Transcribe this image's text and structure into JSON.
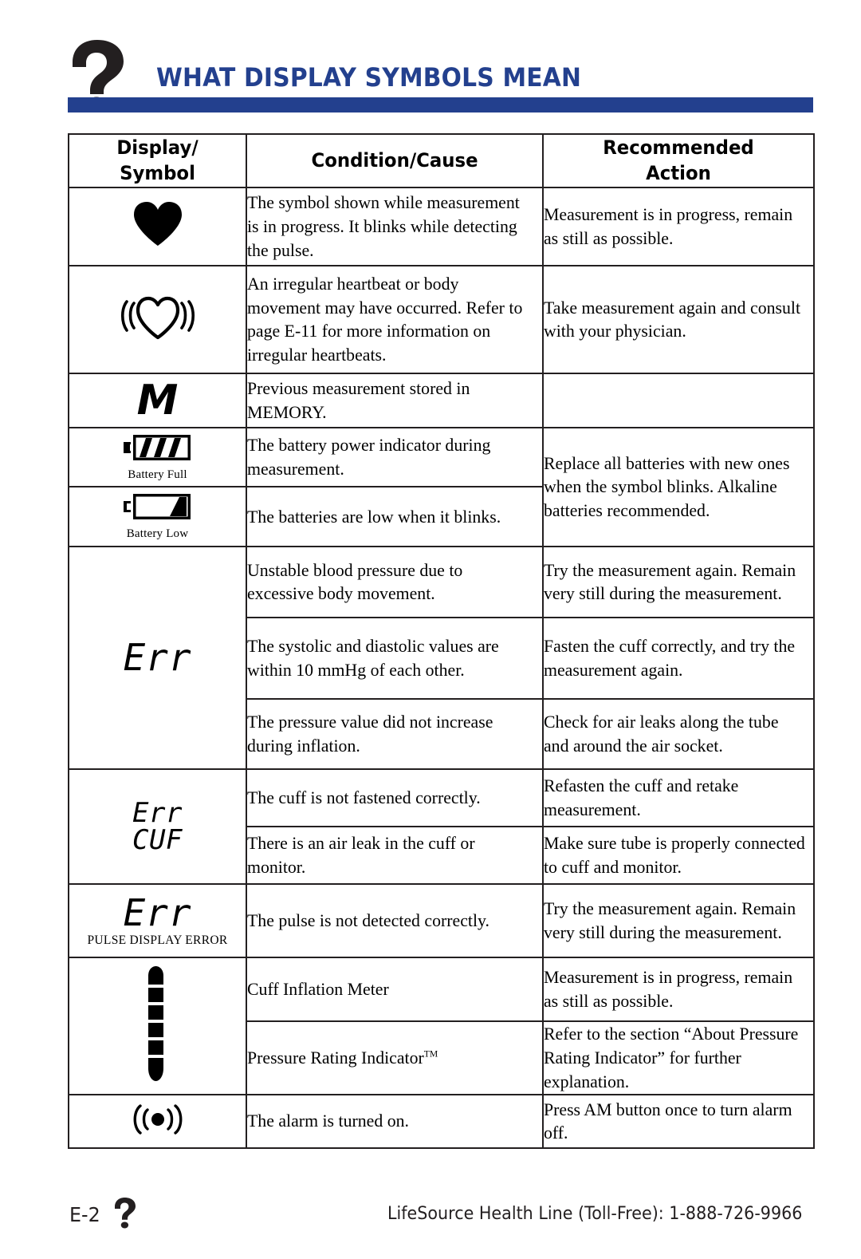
{
  "header": {
    "icon": "question-mark-icon",
    "title": "WHAT DISPLAY SYMBOLS MEAN",
    "accent_color": "#23408e"
  },
  "table": {
    "columns": [
      "Display/\nSymbol",
      "Condition/Cause",
      "Recommended\nAction"
    ],
    "column_headers": {
      "display_symbol_line1": "Display/",
      "display_symbol_line2": "Symbol",
      "condition_cause": "Condition/Cause",
      "recommended_line1": "Recommended",
      "recommended_line2": "Action"
    },
    "rows": [
      {
        "symbol": "heart-filled-icon",
        "symbol_caption": "",
        "condition": "The symbol shown while measurement is in progress. It blinks while detecting the pulse.",
        "action": "Measurement is in progress, remain as still as possible."
      },
      {
        "symbol": "irregular-heartbeat-icon",
        "symbol_caption": "",
        "condition": "An irregular heartbeat or body movement may have occurred. Refer to page E-11 for more information on irregular heartbeats.",
        "action": "Take measurement again and consult with your physician."
      },
      {
        "symbol": "memory-m-icon",
        "symbol_caption": "",
        "condition": "Previous measurement stored in MEMORY.",
        "action": ""
      },
      {
        "symbol": "battery-full-icon",
        "symbol_caption": "Battery Full",
        "condition": "The battery power indicator during measurement.",
        "action": "Replace all batteries with new ones when the symbol blinks. Alkaline batteries recommended."
      },
      {
        "symbol": "battery-low-icon",
        "symbol_caption": "Battery Low",
        "condition": "The batteries are low when it blinks.",
        "action": ""
      },
      {
        "symbol": "err-lcd",
        "symbol_text": "Err",
        "symbol_caption": "",
        "condition": "Unstable blood pressure due to excessive body movement.",
        "action": "Try the measurement again. Remain very still during the measurement."
      },
      {
        "symbol": "err-lcd",
        "symbol_text": "",
        "condition": "The systolic and diastolic values are within 10 mmHg of each other.",
        "action": "Fasten the cuff correctly, and try the measurement again."
      },
      {
        "symbol": "err-lcd",
        "symbol_text": "",
        "condition": "The pressure value did not increase during inflation.",
        "action": "Check for air leaks along the tube and around the air socket."
      },
      {
        "symbol": "err-cuf-lcd",
        "symbol_text_line1": "Err",
        "symbol_text_line2": "CUF",
        "condition": "The cuff is not fastened correctly.",
        "action": "Refasten the cuff and retake measurement."
      },
      {
        "symbol": "err-cuf-lcd",
        "condition": "There is an air leak in the cuff or monitor.",
        "action": "Make sure tube is properly connected to cuff and monitor."
      },
      {
        "symbol": "err-pulse-lcd",
        "symbol_text": "Err",
        "symbol_caption": "PULSE DISPLAY ERROR",
        "condition": "The pulse is not detected correctly.",
        "action": "Try the measurement again. Remain very still during the measurement."
      },
      {
        "symbol": "inflation-meter-icon",
        "condition": "Cuff Inflation Meter",
        "action": "Measurement is in progress, remain as still as possible."
      },
      {
        "symbol": "inflation-meter-icon",
        "condition": "Pressure Rating Indicator",
        "condition_superscript": "TM",
        "action": "Refer to the section “About Pressure Rating Indicator” for further explanation."
      },
      {
        "symbol": "alarm-icon",
        "condition": "The alarm is turned on.",
        "action": "Press AM button once to turn alarm off."
      }
    ]
  },
  "footer": {
    "page_number": "E-2",
    "icon": "question-mark-icon",
    "health_line": "LifeSource Health Line (Toll-Free):  1-888-726-9966"
  }
}
